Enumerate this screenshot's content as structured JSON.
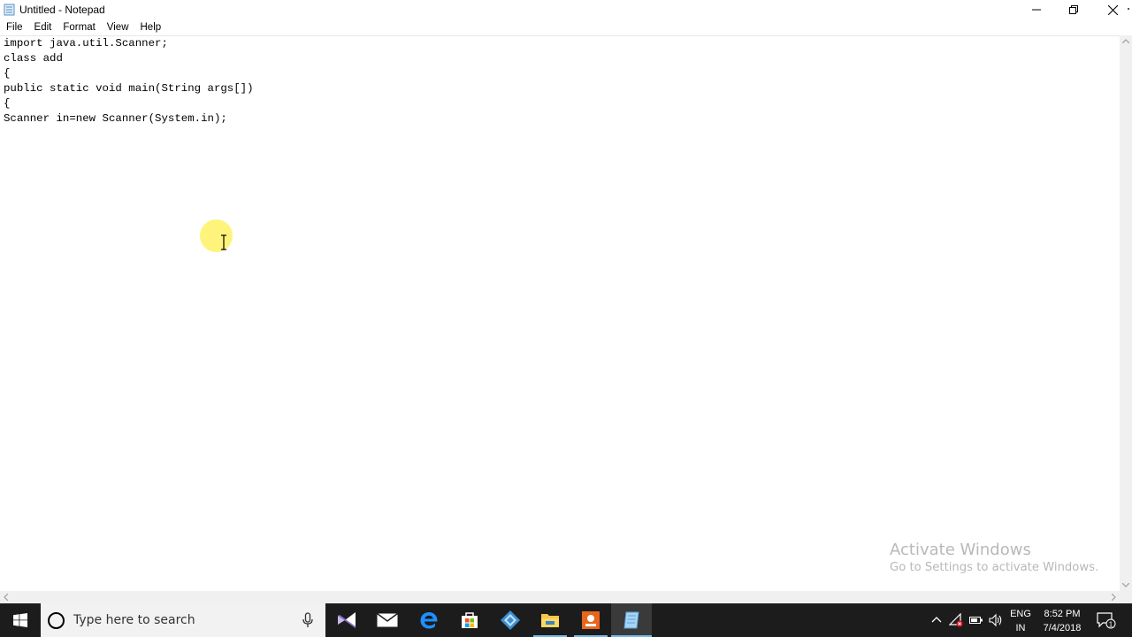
{
  "window": {
    "title": "Untitled - Notepad"
  },
  "menu": [
    "File",
    "Edit",
    "Format",
    "View",
    "Help"
  ],
  "editor": {
    "lines": [
      "import java.util.Scanner;",
      "class add",
      "{",
      "public static void main(String args[])",
      "{",
      "Scanner in=new Scanner(System.in);"
    ]
  },
  "watermark": {
    "title": "Activate Windows",
    "subtitle": "Go to Settings to activate Windows."
  },
  "taskbar": {
    "search_placeholder": "Type here to search",
    "apps": [
      "visual-studio-icon",
      "mail-icon",
      "edge-icon",
      "store-icon",
      "tool-icon",
      "file-explorer-icon",
      "app-orange-icon",
      "notepad-icon"
    ],
    "language": "ENG",
    "region": "IN",
    "time": "8:52 PM",
    "date": "7/4/2018",
    "notification_count": "1"
  },
  "colors": {
    "taskbar_bg": "#1c1c1c",
    "accent": "#76b9ed",
    "cursor_highlight": "#fff264"
  }
}
